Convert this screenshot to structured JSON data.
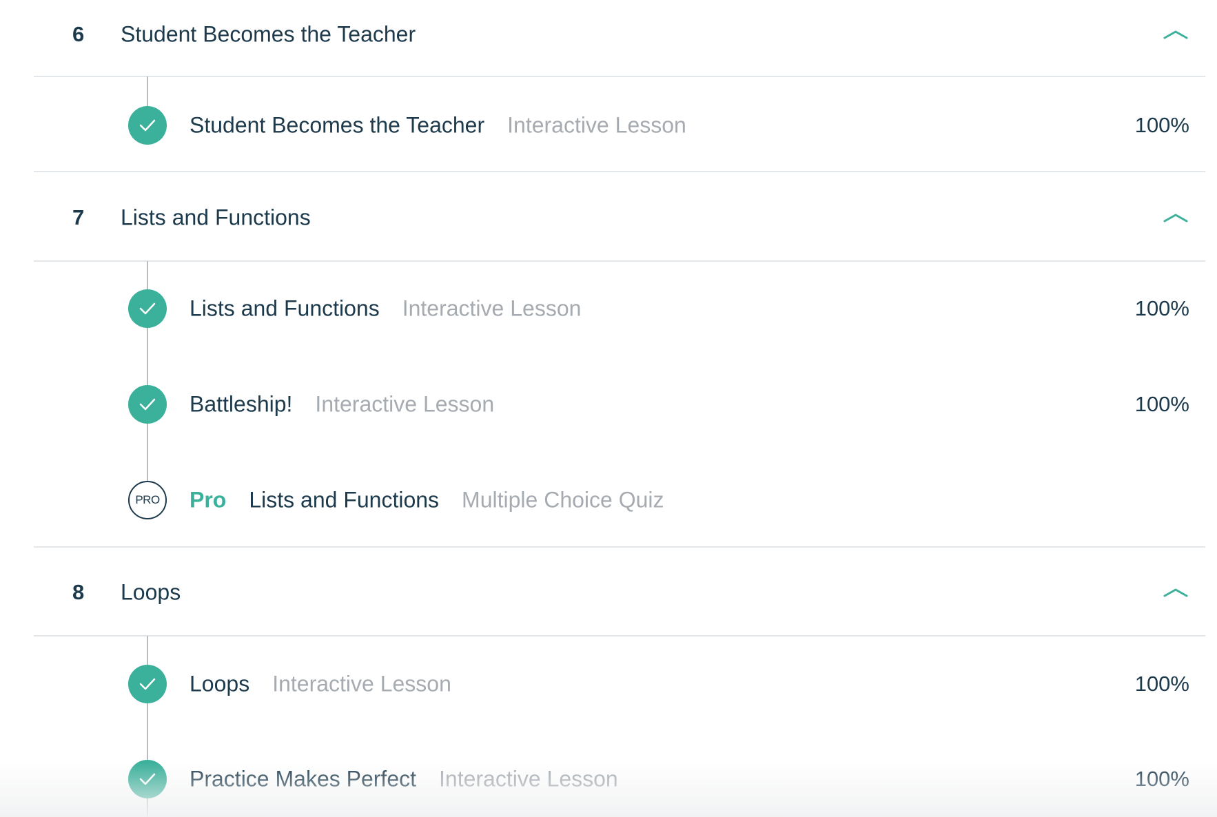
{
  "colors": {
    "accent": "#3bb09a",
    "heading_text": "#1d3a4c",
    "muted_text": "#a5abb0",
    "divider": "#e4e7e9",
    "timeline": "#b7bcc0"
  },
  "sections": [
    {
      "number": "6",
      "title": "Student Becomes the Teacher",
      "expanded": true,
      "toggle_icon": "chevron-up-icon",
      "lessons": [
        {
          "title": "Student Becomes the Teacher",
          "type": "Interactive Lesson",
          "progress": "100%",
          "status": "complete",
          "status_icon": "check-icon"
        }
      ]
    },
    {
      "number": "7",
      "title": "Lists and Functions",
      "expanded": true,
      "toggle_icon": "chevron-up-icon",
      "lessons": [
        {
          "title": "Lists and Functions",
          "type": "Interactive Lesson",
          "progress": "100%",
          "status": "complete",
          "status_icon": "check-icon"
        },
        {
          "title": "Battleship!",
          "type": "Interactive Lesson",
          "progress": "100%",
          "status": "complete",
          "status_icon": "check-icon"
        },
        {
          "pro_badge": "PRO",
          "pro_label": "Pro",
          "title": "Lists and Functions",
          "type": "Multiple Choice Quiz",
          "status": "locked-pro",
          "status_icon": "pro-badge-icon"
        }
      ]
    },
    {
      "number": "8",
      "title": "Loops",
      "expanded": true,
      "toggle_icon": "chevron-up-icon",
      "lessons": [
        {
          "title": "Loops",
          "type": "Interactive Lesson",
          "progress": "100%",
          "status": "complete",
          "status_icon": "check-icon"
        },
        {
          "title": "Practice Makes Perfect",
          "type": "Interactive Lesson",
          "progress": "100%",
          "status": "complete",
          "status_icon": "check-icon"
        }
      ]
    }
  ]
}
